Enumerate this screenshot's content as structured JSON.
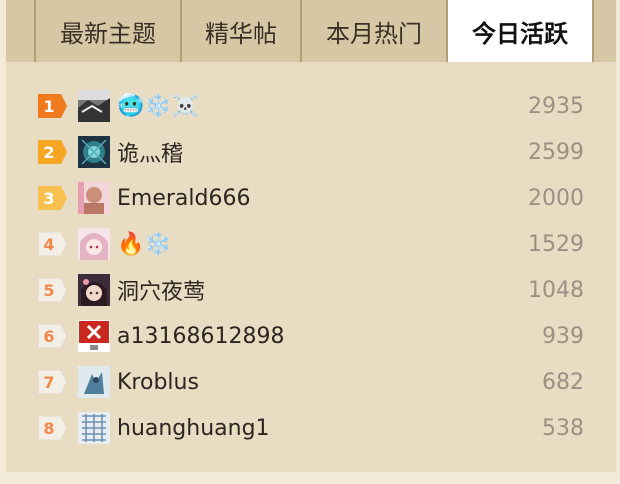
{
  "tabs": [
    {
      "label": "最新主题"
    },
    {
      "label": "精华帖"
    },
    {
      "label": "本月热门"
    },
    {
      "label": "今日活跃"
    }
  ],
  "active_tab": "今日活跃",
  "ranking": [
    {
      "rank": "1",
      "name": "🥶❄️☠️",
      "score": "2935"
    },
    {
      "rank": "2",
      "name": "诡灬稽",
      "score": "2599"
    },
    {
      "rank": "3",
      "name": "Emerald666",
      "score": "2000"
    },
    {
      "rank": "4",
      "name": "🔥❄️",
      "score": "1529"
    },
    {
      "rank": "5",
      "name": "洞穴夜莺",
      "score": "1048"
    },
    {
      "rank": "6",
      "name": "a13168612898",
      "score": "939"
    },
    {
      "rank": "7",
      "name": "Kroblus",
      "score": "682"
    },
    {
      "rank": "8",
      "name": "huanghuang1",
      "score": "538"
    }
  ],
  "colors": {
    "rank1": "#f07a1e",
    "rank2": "#f5a623",
    "rank3": "#f7c04f",
    "rank_other_bg": "#f3eee6",
    "rank_other_text": "#f0894a"
  }
}
